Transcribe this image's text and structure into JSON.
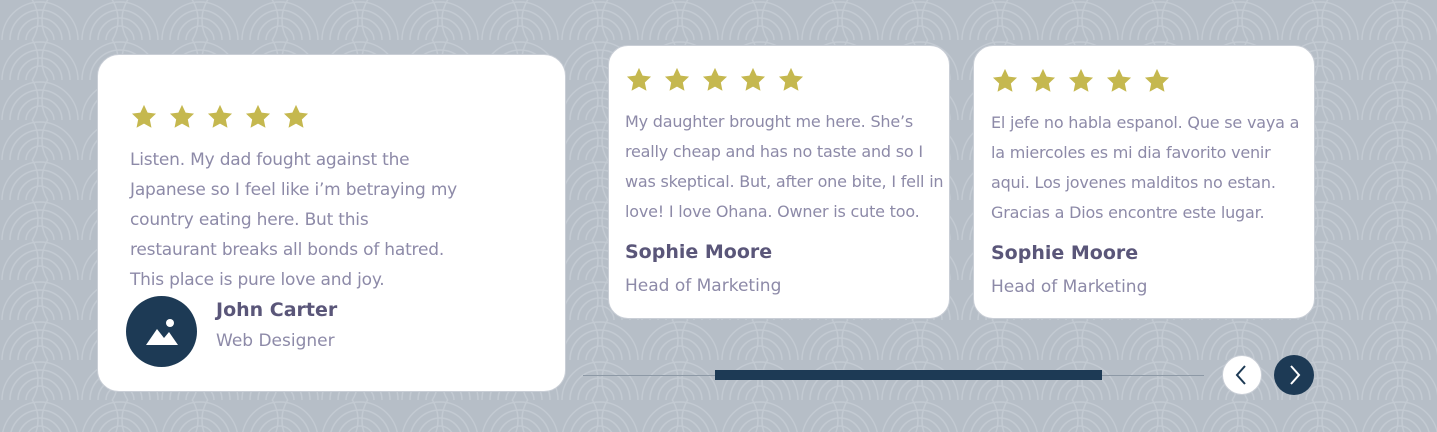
{
  "colors": {
    "background": "#b6bec7",
    "card": "#ffffff",
    "star": "#c5b84f",
    "accent_dark": "#1d3a55",
    "name_text": "#5a5679",
    "body_text": "#8d8aa8"
  },
  "testimonials": [
    {
      "rating": 5,
      "review": "Listen. My dad fought against the Japanese so I feel like i’m betraying my country eating here. But this restaurant breaks all bonds of hatred. This place is pure love and joy.",
      "name": "John Carter",
      "role": "Web Designer",
      "avatar_icon": "image-placeholder-icon"
    },
    {
      "rating": 5,
      "review": "My daughter brought me here. She’s really cheap and has no taste and so I was skeptical. But, after one bite, I fell in love! I love Ohana. Owner is cute too.",
      "name": "Sophie Moore",
      "role": "Head of Marketing"
    },
    {
      "rating": 5,
      "review": "El jefe no habla espanol. Que se vaya a la miercoles es mi dia favorito venir aqui. Los jovenes malditos no estan. Gracias a Dios encontre este lugar.",
      "name": "Sophie Moore",
      "role": "Head of Marketing"
    }
  ],
  "slider": {
    "progress_fraction": 0.62,
    "prev_icon": "chevron-left-icon",
    "next_icon": "chevron-right-icon"
  }
}
